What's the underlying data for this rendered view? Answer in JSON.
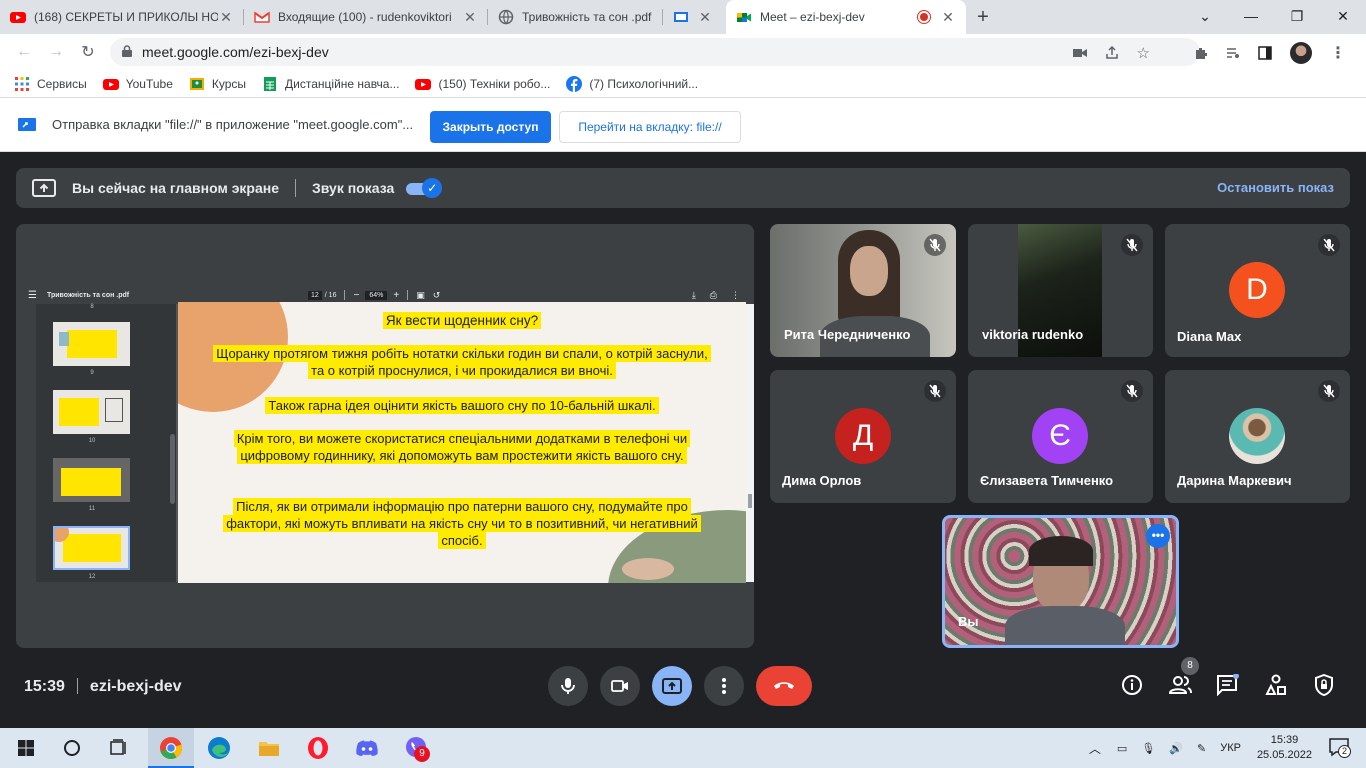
{
  "browser": {
    "tabs": [
      {
        "title": "(168) СЕКРЕТЫ И ПРИКОЛЫ НОВ",
        "favicon": "youtube-icon",
        "active": false
      },
      {
        "title": "Входящие (100) - rudenkoviktori",
        "favicon": "gmail-icon",
        "active": false
      },
      {
        "title": "Тривожність та сон .pdf",
        "favicon": "globe-icon",
        "active": false
      },
      {
        "title": "",
        "favicon": "screen-share-icon",
        "active": false
      },
      {
        "title": "Meet – ezi-bexj-dev",
        "favicon": "meet-icon",
        "active": true
      }
    ],
    "address": "meet.google.com/ezi-bexj-dev",
    "bookmarks": [
      {
        "label": "Сервисы",
        "icon": "apps-grid-icon"
      },
      {
        "label": "YouTube",
        "icon": "youtube-icon"
      },
      {
        "label": "Курсы",
        "icon": "classroom-icon"
      },
      {
        "label": "Дистанційне навча...",
        "icon": "sheets-icon"
      },
      {
        "label": "(150) Техніки робо...",
        "icon": "youtube-icon"
      },
      {
        "label": "(7) Психологічний...",
        "icon": "facebook-icon"
      }
    ],
    "infobar": {
      "message": "Отправка вкладки \"file://\" в приложение \"meet.google.com\"...",
      "close_access": "Закрыть доступ",
      "go_to_tab": "Перейти на вкладку: file://"
    }
  },
  "meet": {
    "banner": {
      "presenting": "Вы сейчас на главном экране",
      "sound": "Звук показа",
      "stop": "Остановить показ"
    },
    "pdf": {
      "filename": "Тривожність та сон .pdf",
      "page_current": "12",
      "page_total": "/ 16",
      "zoom": "64%",
      "thumb_numbers": [
        "8",
        "9",
        "10",
        "11",
        "12"
      ],
      "heading": "Як вести щоденник сну?",
      "paragraphs": [
        "Щоранку протягом тижня робіть нотатки скільки годин ви спали, о котрій заснули, та о котрій проснулися, і чи прокидалися ви вночі.",
        "Також гарна ідея оцінити якість вашого сну по 10-бальній шкалі.",
        "Крім того, ви можете скористатися спеціальними додатками в телефоні чи цифровому годиннику, які допоможуть вам простежити якість вашого сну.",
        "Після, як ви отримали інформацію про патерни вашого сну, подумайте про фактори, які можуть впливати на якість сну чи то в позитивний, чи негативний спосіб."
      ]
    },
    "participants": [
      {
        "name": "Рита Чередниченко",
        "type": "video"
      },
      {
        "name": "viktoria rudenko",
        "type": "video"
      },
      {
        "name": "Diana Max",
        "type": "avatar",
        "initial": "D",
        "color": "#f4511e"
      },
      {
        "name": "Дима Орлов",
        "type": "avatar",
        "initial": "Д",
        "color": "#c5221f"
      },
      {
        "name": "Єлизавета Тимченко",
        "type": "avatar",
        "initial": "Є",
        "color": "#a142f4"
      },
      {
        "name": "Дарина Маркевич",
        "type": "photo"
      },
      {
        "name": "Вы",
        "type": "self"
      }
    ],
    "time": "15:39",
    "meeting_code": "ezi-bexj-dev",
    "people_count": "8"
  },
  "taskbar": {
    "lang": "УКР",
    "time": "15:39",
    "date": "25.05.2022",
    "viber_badge": "9",
    "notif_count": "2"
  }
}
